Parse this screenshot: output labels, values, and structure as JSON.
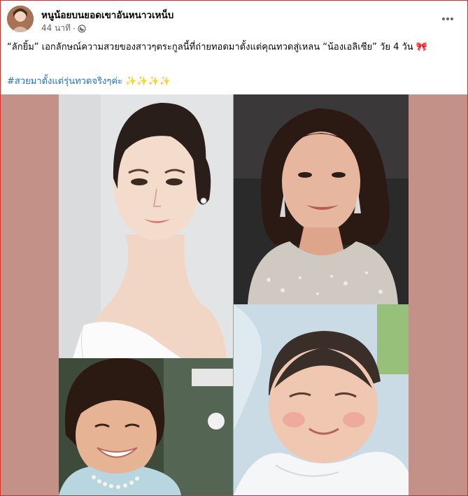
{
  "post": {
    "page_name": "หนูน้อยบนยอดเขาอันหนาวเหน็บ",
    "time_ago": "44 นาที",
    "dot": "·",
    "body_text": "“ลักยิ้ม” เอกลักษณ์ความสวยของสาวๆตระกูลนี้ที่ถ่ายทอดมาตั้งแต่คุณทวดสู่เหลน “น้องเอลิเซีย” วัย 4 วัน 🎀",
    "hashtag": "#สวยมาตั้งแต่รุ่นทวดจริงๆค่ะ",
    "sparkles": "✨✨✨✨"
  },
  "icons": {
    "privacy": "globe-icon",
    "more": "more-options-icon"
  },
  "colors": {
    "name": "#050505",
    "meta": "#65676b",
    "hashtag": "#216fdb",
    "media_background": "#c49189",
    "frame_border": "#d0312d"
  }
}
